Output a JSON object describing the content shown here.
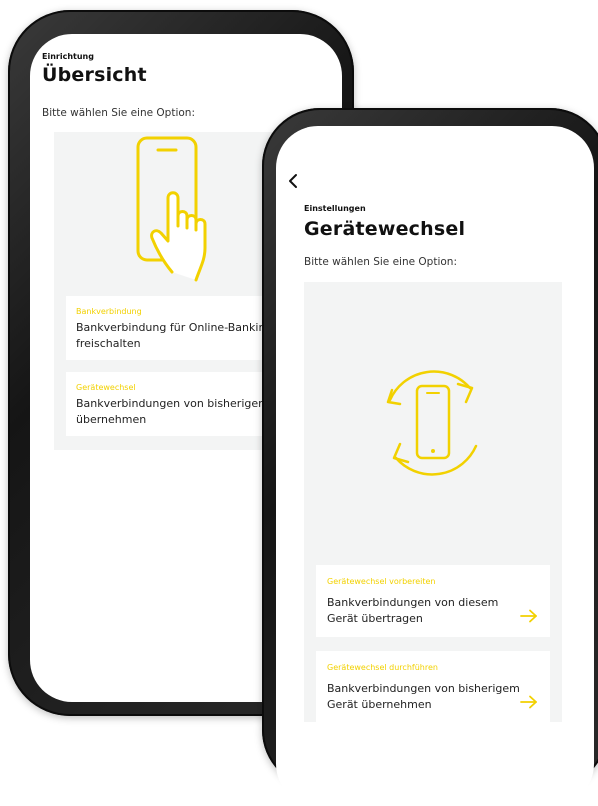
{
  "back_screen": {
    "eyebrow": "Einrichtung",
    "title": "Übersicht",
    "prompt": "Bitte wählen Sie eine Option:",
    "options": [
      {
        "tag": "Bankverbindung",
        "line1": "Bankverbindung für Online-Banking",
        "line2": "freischalten"
      },
      {
        "tag": "Gerätewechsel",
        "line1": "Bankverbindungen von bisherigem Ge",
        "line2": "übernehmen"
      }
    ]
  },
  "front_screen": {
    "eyebrow": "Einstellungen",
    "title": "Gerätewechsel",
    "prompt": "Bitte wählen Sie eine Option:",
    "options": [
      {
        "tag": "Gerätewechsel vorbereiten",
        "line1": "Bankverbindungen von diesem",
        "line2": "Gerät übertragen"
      },
      {
        "tag": "Gerätewechsel durchführen",
        "line1": "Bankverbindungen von bisherigem",
        "line2": "Gerät übernehmen"
      }
    ]
  },
  "colors": {
    "accent": "#f2d100",
    "panel": "#f3f4f4",
    "text": "#222222",
    "frame": "#1c1c1c"
  },
  "icons": [
    "tap-phone-icon",
    "device-switch-icon",
    "back-chevron-icon",
    "arrow-right-icon"
  ]
}
